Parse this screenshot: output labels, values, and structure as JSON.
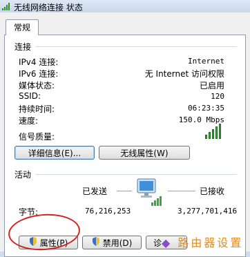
{
  "window": {
    "title": "无线网络连接 状态"
  },
  "tabs": [
    {
      "label": "常规"
    }
  ],
  "connection": {
    "section_label": "连接",
    "rows": [
      {
        "label": "IPv4 连接:",
        "value": "Internet"
      },
      {
        "label": "IPv6 连接:",
        "value": "无 Internet 访问权限"
      },
      {
        "label": "媒体状态:",
        "value": "已启用"
      },
      {
        "label": "SSID:",
        "value": "120"
      },
      {
        "label": "持续时间:",
        "value": "06:23:35"
      },
      {
        "label": "速度:",
        "value": "150.0 Mbps"
      }
    ],
    "signal_label": "信号质量:",
    "signal_bars": 5,
    "signal_bars_max": 5,
    "details_button": "详细信息(E)...",
    "wireless_props_button": "无线属性(W)"
  },
  "activity": {
    "section_label": "活动",
    "sent_label": "已发送",
    "received_label": "已接收",
    "bytes_label": "字节:",
    "bytes_sent": "76,216,253",
    "bytes_received": "3,277,701,416"
  },
  "buttons": {
    "properties": "属性(P)",
    "disable": "禁用(D)",
    "diagnose": "诊"
  },
  "watermark": {
    "text": "路由器设置"
  },
  "colors": {
    "annotation_red": "#d62020",
    "signal_green": "#3aa83a",
    "watermark_purple": "#8a4bc7",
    "watermark_orange": "#e28a1a"
  }
}
